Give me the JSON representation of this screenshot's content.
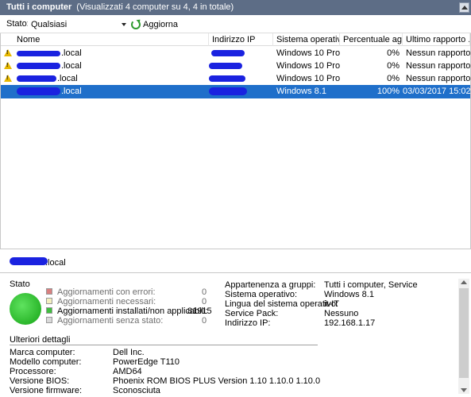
{
  "titlebar": {
    "title": "Tutti i computer",
    "subtitle": "(Visualizzati 4 computer su 4, 4 in totale)"
  },
  "toolbar": {
    "status_label": "Stato:",
    "status_value": "Qualsiasi",
    "refresh_label": "Aggiorna"
  },
  "columns": [
    "Nome",
    "Indirizzo IP",
    "Sistema operativo",
    "Percentuale ag...",
    "Ultimo rapporto ..."
  ],
  "rows": [
    {
      "name_visible": ".local",
      "os": "Windows 10 Pro",
      "percent": "0%",
      "last": "Nessun rapporto ..."
    },
    {
      "name_visible": ".local",
      "os": "Windows 10 Pro",
      "percent": "0%",
      "last": "Nessun rapporto ..."
    },
    {
      "name_visible": ".local",
      "os": "Windows 10 Pro",
      "percent": "0%",
      "last": "Nessun rapporto ..."
    },
    {
      "name_visible": ".local",
      "os": "Windows 8.1",
      "percent": "100%",
      "last": "03/03/2017 15:02"
    }
  ],
  "selected_computer": {
    "name_visible": ".local"
  },
  "status_panel": {
    "title": "Stato",
    "items": [
      {
        "label": "Aggiornamenti con errori:",
        "value": "0",
        "color": "#d98080"
      },
      {
        "label": "Aggiornamenti necessari:",
        "value": "0",
        "color": "#f3efbf"
      },
      {
        "label": "Aggiornamenti installati/non applicabili:",
        "value": "81915",
        "color": "#3fbe3f"
      },
      {
        "label": "Aggiornamenti senza stato:",
        "value": "0",
        "color": "#d9d9d9"
      }
    ]
  },
  "info": [
    {
      "key": "Appartenenza a gruppi:",
      "value": "Tutti i computer, Service"
    },
    {
      "key": "Sistema operativo:",
      "value": "Windows 8.1"
    },
    {
      "key": "Lingua del sistema operativo:",
      "value": "it-IT"
    },
    {
      "key": "Service Pack:",
      "value": "Nessuno"
    },
    {
      "key": "Indirizzo IP:",
      "value": "192.168.1.17"
    }
  ],
  "more_details": {
    "title": "Ulteriori dettagli",
    "items": [
      {
        "key": "Marca computer:",
        "value": "Dell Inc."
      },
      {
        "key": "Modello computer:",
        "value": "PowerEdge T110"
      },
      {
        "key": "Processore:",
        "value": "AMD64"
      },
      {
        "key": "Versione BIOS:",
        "value": "Phoenix ROM BIOS PLUS Version 1.10 1.10.0 1.10.0"
      },
      {
        "key": "Versione firmware:",
        "value": "Sconosciuta"
      }
    ]
  },
  "colors": {
    "titlebar": "#5d6d86",
    "selection": "#1f6fca",
    "redaction": "#1a22e0",
    "status_ok": "#2ecc2e"
  }
}
